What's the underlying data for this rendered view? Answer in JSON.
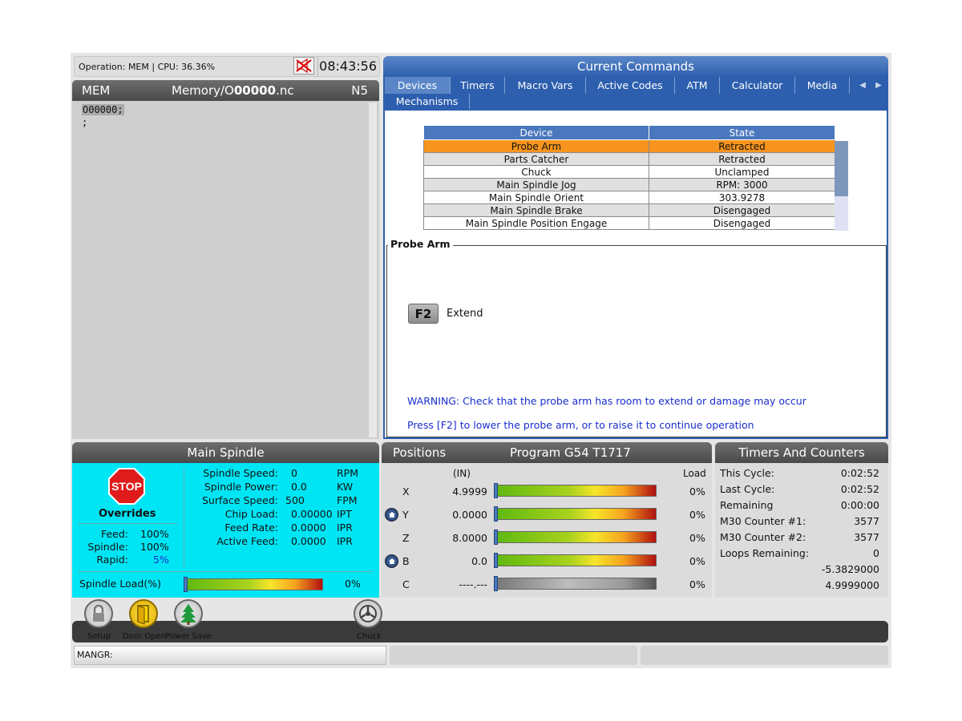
{
  "status": {
    "operation_text": "Operation: MEM | CPU: 36.36%",
    "clock": "08:43:56"
  },
  "program": {
    "mode": "MEM",
    "file_prefix": "Memory/O",
    "file_number": "00000",
    "file_ext": ".nc",
    "line": "N5",
    "code_lines": [
      "O00000;",
      ";"
    ]
  },
  "current_commands": {
    "title": "Current Commands",
    "tabs": [
      "Devices",
      "Timers",
      "Macro Vars",
      "Active Codes",
      "ATM",
      "Calculator",
      "Media"
    ],
    "active_tab": "Devices",
    "subtabs": [
      "Mechanisms"
    ],
    "table": {
      "headers": [
        "Device",
        "State"
      ],
      "rows": [
        {
          "device": "Probe Arm",
          "state": "Retracted"
        },
        {
          "device": "Parts Catcher",
          "state": "Retracted"
        },
        {
          "device": "Chuck",
          "state": "Unclamped"
        },
        {
          "device": "Main Spindle Jog",
          "state": "RPM: 3000"
        },
        {
          "device": "Main Spindle Orient",
          "state": "303.9278"
        },
        {
          "device": "Main Spindle Brake",
          "state": "Disengaged"
        },
        {
          "device": "Main Spindle Position Engage",
          "state": "Disengaged"
        }
      ],
      "selected_row": 0,
      "scroll_fraction": 0.62
    },
    "detail": {
      "title": "Probe Arm",
      "key_label": "F2",
      "key_action": "Extend",
      "warning": "WARNING: Check that the probe arm has room to extend or damage may occur",
      "instruction": "Press [F2] to lower the probe arm, or to raise it to continue operation"
    }
  },
  "main_spindle": {
    "title": "Main Spindle",
    "stop_label": "STOP",
    "overrides_label": "Overrides",
    "overrides": [
      {
        "label": "Feed:",
        "value": "100%"
      },
      {
        "label": "Spindle:",
        "value": "100%"
      },
      {
        "label": "Rapid:",
        "value": "5%"
      }
    ],
    "stats": [
      {
        "label": "Spindle Speed:",
        "value": "0",
        "unit": "RPM"
      },
      {
        "label": "Spindle Power:",
        "value": "0.0",
        "unit": "KW"
      },
      {
        "label": "Surface Speed:",
        "value": "500",
        "unit": "FPM"
      },
      {
        "label": "Chip Load:",
        "value": "0.00000",
        "unit": "IPT"
      },
      {
        "label": "Feed Rate:",
        "value": "0.0000",
        "unit": "IPR"
      },
      {
        "label": "Active Feed:",
        "value": "0.0000",
        "unit": "IPR"
      }
    ],
    "load_label": "Spindle Load(%)",
    "load_value": "0%",
    "load_fraction": 0.0
  },
  "positions": {
    "title": "Positions",
    "program": "Program G54 T1717",
    "units": "(IN)",
    "load_header": "Load",
    "axes": [
      {
        "axis": "X",
        "value": "4.9999",
        "load": "0%",
        "home": false,
        "active": true
      },
      {
        "axis": "Y",
        "value": "0.0000",
        "load": "0%",
        "home": true,
        "active": true
      },
      {
        "axis": "Z",
        "value": "8.0000",
        "load": "0%",
        "home": false,
        "active": true
      },
      {
        "axis": "B",
        "value": "0.0",
        "load": "0%",
        "home": true,
        "active": true
      },
      {
        "axis": "C",
        "value": "----.---",
        "load": "0%",
        "home": false,
        "active": false
      }
    ]
  },
  "timers": {
    "title": "Timers And Counters",
    "rows": [
      {
        "label": "This Cycle:",
        "value": "0:02:52"
      },
      {
        "label": "Last Cycle:",
        "value": "0:02:52"
      },
      {
        "label": "Remaining",
        "value": "0:00:00"
      },
      {
        "label": "M30 Counter #1:",
        "value": "3577"
      },
      {
        "label": "M30 Counter #2:",
        "value": "3577"
      },
      {
        "label": "Loops Remaining:",
        "value": "0"
      }
    ],
    "extra_values": [
      "-5.3829000",
      "4.9999000"
    ]
  },
  "bottom_icons": [
    {
      "label": "Setup",
      "icon": "lock-icon"
    },
    {
      "label": "Door Open",
      "icon": "door-icon"
    },
    {
      "label": "Power Save",
      "icon": "tree-icon"
    },
    {
      "label": "Chuck",
      "icon": "chuck-icon"
    }
  ],
  "input_line": "MANGR:"
}
